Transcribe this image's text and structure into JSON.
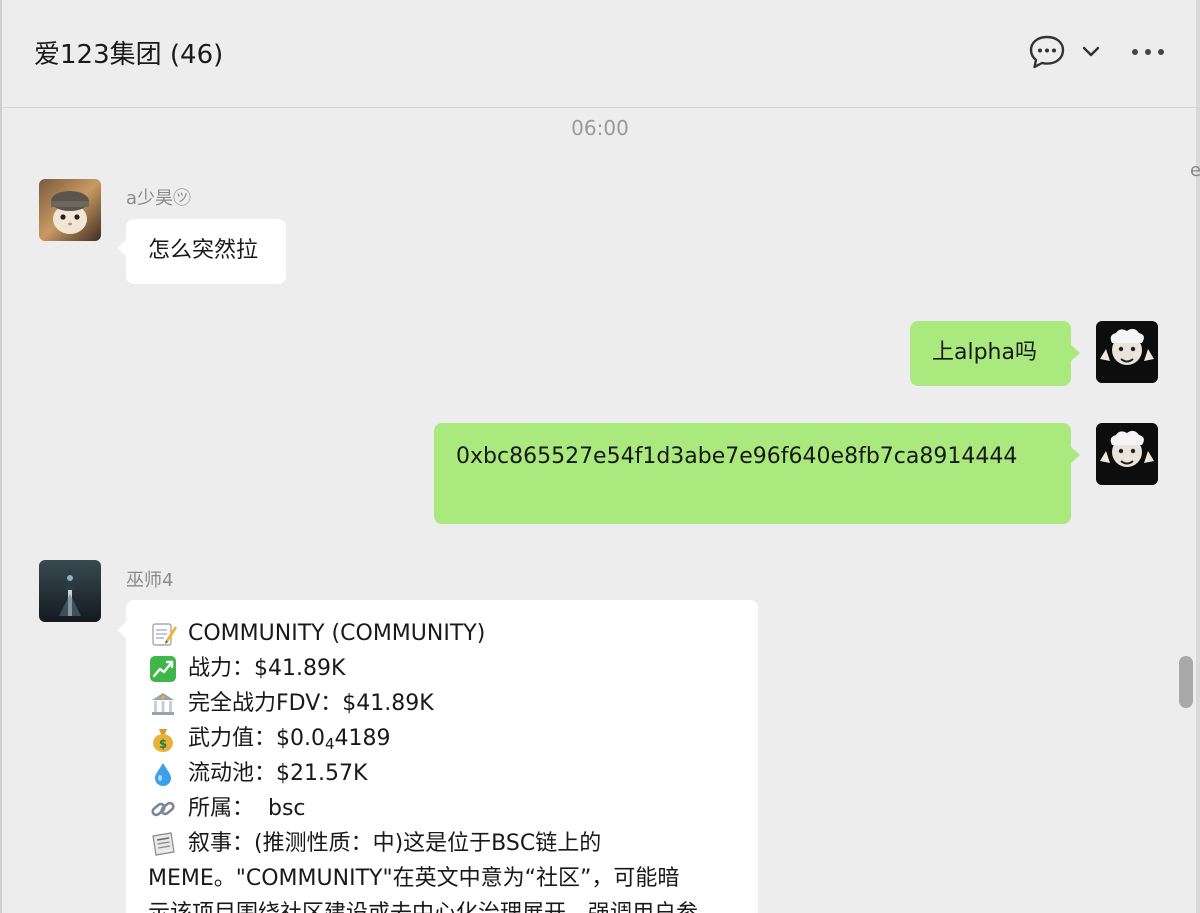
{
  "window": {
    "title": "爱123集团 (46)"
  },
  "header_icons": {
    "chat": "chat-bubble-icon",
    "chevron": "chevron-down-icon",
    "more": "more-dots-icon"
  },
  "timestamp": "06:00",
  "messages": [
    {
      "sender": "a少昊㋡",
      "text": "怎么突然拉",
      "side": "left"
    },
    {
      "text": "上alpha吗",
      "side": "right"
    },
    {
      "text": "0xbc865527e54f1d3abe7e96f640e8fb7ca8914444",
      "side": "right"
    }
  ],
  "bot": {
    "sender": "巫师4",
    "lines": [
      {
        "icon": "memo-icon",
        "text": "COMMUNITY (COMMUNITY)"
      },
      {
        "icon": "chart-up-icon",
        "text": "战力：$41.89K"
      },
      {
        "icon": "bank-icon",
        "text": "完全战力FDV：$41.89K"
      },
      {
        "icon": "money-bag-icon",
        "text_pre": "武力值：$0.0",
        "subscript": "4",
        "text_post": "4189"
      },
      {
        "icon": "droplet-icon",
        "text": "流动池：$21.57K"
      },
      {
        "icon": "link-icon",
        "text": "所属：  bsc"
      },
      {
        "icon": "newspaper-icon",
        "text": "叙事：(推测性质：中)这是位于BSC链上的"
      }
    ],
    "line8": "MEME。\"COMMUNITY\"在英文中意为“社区”，可能暗",
    "line9": "示该项目围绕社区建设或去中心化治理展开，强调用户参"
  },
  "colors": {
    "green_bubble": "#a9e97e",
    "white_bubble": "#ffffff",
    "background": "#ededed"
  },
  "fragment": "e"
}
